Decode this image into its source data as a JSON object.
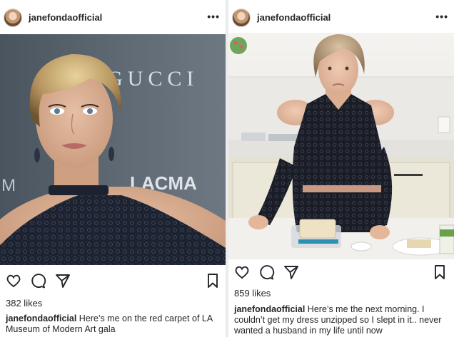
{
  "left_post": {
    "username": "janefondaofficial",
    "more_label": "•••",
    "backdrop_gucci": "GUCCI",
    "backdrop_lacma": "LACMA",
    "backdrop_m": "M",
    "likes": "382 likes",
    "caption_user": "janefondaofficial",
    "caption_text": " Here’s me on the red carpet of LA Museum of Modern Art gala"
  },
  "right_post": {
    "username": "janefondaofficial",
    "more_label": "•••",
    "likes": "859 likes",
    "caption_user": "janefondaofficial",
    "caption_text": " Here’s me the next morning. I couldn’t get my dress unzipped so I slept in it.. never wanted a husband in my life until now"
  },
  "colors": {
    "text": "#262626",
    "story_strip": "#c040c8",
    "backdrop": "#5c6670",
    "dress": "#1c2230"
  },
  "icons": [
    "heart-icon",
    "comment-icon",
    "share-icon",
    "bookmark-icon",
    "more-icon"
  ]
}
